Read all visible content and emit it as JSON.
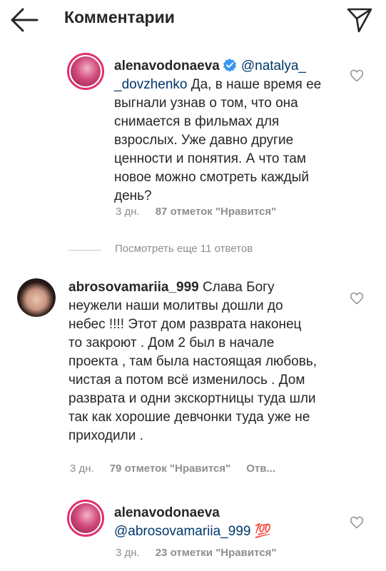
{
  "header": {
    "title": "Комментарии"
  },
  "comments": [
    {
      "username": "alenavodonaeva",
      "mention": "@natalya_\n_dovzhenko",
      "text": " Да, в наше время ее выгнали узнав о том, что она снимается в фильмах для взрослых. Уже давно другие ценности и понятия. А что там новое можно смотреть каждый день?",
      "time": "3 дн.",
      "likes": "87 отметок \"Нравится\""
    },
    {
      "username": "abrosovamariia_999",
      "text": " Слава Богу неужели  наши молитвы дошли до небес !!!! Этот дом разврата наконец то закроют . Дом 2 был в начале проекта , там была настоящая любовь, чистая а потом всё изменилось . Дом разврата и одни экскортницы туда шли так как хорошие девчонки туда уже  не приходили .",
      "time": "3 дн.",
      "likes": "79 отметок \"Нравится\"",
      "reply": "Отв..."
    },
    {
      "username": "alenavodonaeva",
      "mention": "@abrosovamariia_999",
      "emoji": "💯",
      "time": "3 дн.",
      "likes": "23 отметки \"Нравится\""
    }
  ],
  "view_more": "Посмотреть еще 11 ответов",
  "colors": {
    "mention": "#00376b",
    "story_ring": "#e1306c",
    "verified": "#3897f0",
    "meta": "#8e8e8e"
  }
}
